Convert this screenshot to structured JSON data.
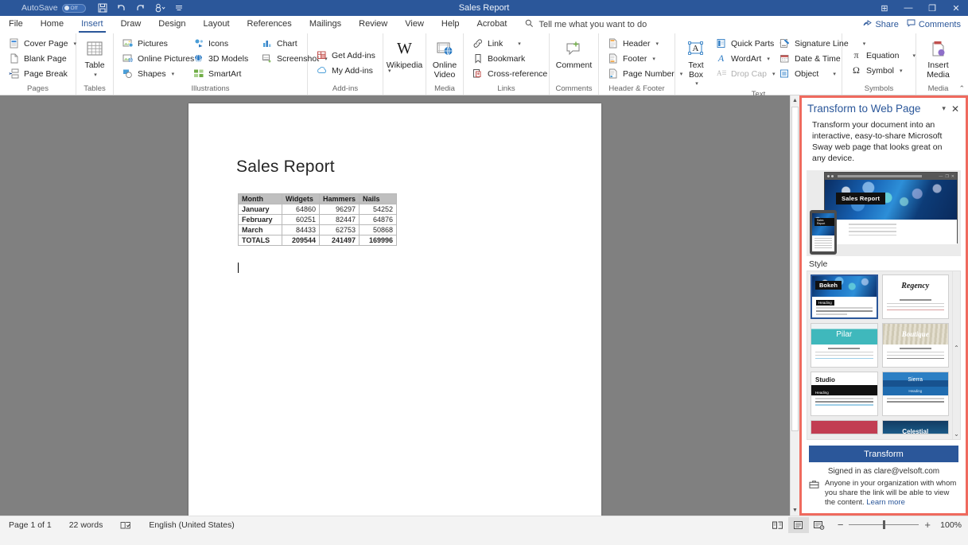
{
  "titlebar": {
    "autosave_label": "AutoSave",
    "autosave_state": "Off",
    "document_title": "Sales Report",
    "qat": [
      {
        "name": "save-icon",
        "tooltip": "Save"
      },
      {
        "name": "undo-icon",
        "tooltip": "Undo"
      },
      {
        "name": "redo-icon",
        "tooltip": "Redo"
      },
      {
        "name": "customize-qat-icon",
        "tooltip": "Customize Quick Access Toolbar"
      },
      {
        "name": "ribbon-display-options-icon",
        "tooltip": "Ribbon Display Options"
      }
    ],
    "window_buttons": {
      "restore_down_pane": "⊞",
      "minimize": "—",
      "maximize": "❐",
      "close": "✕"
    }
  },
  "tabs": [
    {
      "label": "File",
      "active": false
    },
    {
      "label": "Home",
      "active": false
    },
    {
      "label": "Insert",
      "active": true
    },
    {
      "label": "Draw",
      "active": false
    },
    {
      "label": "Design",
      "active": false
    },
    {
      "label": "Layout",
      "active": false
    },
    {
      "label": "References",
      "active": false
    },
    {
      "label": "Mailings",
      "active": false
    },
    {
      "label": "Review",
      "active": false
    },
    {
      "label": "View",
      "active": false
    },
    {
      "label": "Help",
      "active": false
    },
    {
      "label": "Acrobat",
      "active": false
    }
  ],
  "tellme": {
    "placeholder": "Tell me what you want to do"
  },
  "share": {
    "share_label": "Share",
    "comments_label": "Comments"
  },
  "ribbon": {
    "collapse_label": "⌃",
    "groups": [
      {
        "label": "Pages",
        "items": [
          {
            "label": "Cover Page",
            "icon": "cover-page-icon",
            "dropdown": true
          },
          {
            "label": "Blank Page",
            "icon": "blank-page-icon",
            "dropdown": false
          },
          {
            "label": "Page Break",
            "icon": "page-break-icon",
            "dropdown": false
          }
        ]
      },
      {
        "label": "Tables",
        "big_items": [
          {
            "label": "Table",
            "icon": "table-icon",
            "dropdown": true
          }
        ]
      },
      {
        "label": "Illustrations",
        "items": [
          {
            "label": "Pictures",
            "icon": "pictures-icon",
            "dropdown": false
          },
          {
            "label": "Online Pictures",
            "icon": "online-pictures-icon",
            "dropdown": false
          },
          {
            "label": "Shapes",
            "icon": "shapes-icon",
            "dropdown": true
          },
          {
            "label": "Icons",
            "icon": "icons-icon",
            "dropdown": false
          },
          {
            "label": "3D Models",
            "icon": "3d-models-icon",
            "dropdown": true
          },
          {
            "label": "SmartArt",
            "icon": "smartart-icon",
            "dropdown": false
          },
          {
            "label": "Chart",
            "icon": "chart-icon",
            "dropdown": false
          },
          {
            "label": "Screenshot",
            "icon": "screenshot-icon",
            "dropdown": true
          }
        ]
      },
      {
        "label": "Add-ins",
        "items": [
          {
            "label": "Get Add-ins",
            "icon": "get-addins-icon",
            "dropdown": false
          },
          {
            "label": "My Add-ins",
            "icon": "my-addins-icon",
            "dropdown": true
          }
        ]
      },
      {
        "label": "",
        "big_items": [
          {
            "label": "Wikipedia",
            "icon": "wikipedia-icon",
            "dropdown": false
          }
        ]
      },
      {
        "label": "Media",
        "big_items": [
          {
            "label": "Online Video",
            "icon": "online-video-icon",
            "dropdown": false
          }
        ]
      },
      {
        "label": "Links",
        "items": [
          {
            "label": "Link",
            "icon": "link-icon",
            "dropdown": true
          },
          {
            "label": "Bookmark",
            "icon": "bookmark-icon",
            "dropdown": false
          },
          {
            "label": "Cross-reference",
            "icon": "cross-reference-icon",
            "dropdown": false
          }
        ]
      },
      {
        "label": "Comments",
        "big_items": [
          {
            "label": "Comment",
            "icon": "comment-icon",
            "dropdown": false
          }
        ]
      },
      {
        "label": "Header & Footer",
        "items": [
          {
            "label": "Header",
            "icon": "header-icon",
            "dropdown": true
          },
          {
            "label": "Footer",
            "icon": "footer-icon",
            "dropdown": true
          },
          {
            "label": "Page Number",
            "icon": "page-number-icon",
            "dropdown": true
          }
        ]
      },
      {
        "label": "Text",
        "big_items": [
          {
            "label": "Text Box",
            "icon": "text-box-icon",
            "dropdown": true
          }
        ],
        "items": [
          {
            "label": "Quick Parts",
            "icon": "quick-parts-icon",
            "dropdown": true
          },
          {
            "label": "WordArt",
            "icon": "wordart-icon",
            "dropdown": true
          },
          {
            "label": "Drop Cap",
            "icon": "drop-cap-icon",
            "dropdown": true,
            "disabled": true
          },
          {
            "label": "Signature Line",
            "icon": "signature-line-icon",
            "dropdown": true
          },
          {
            "label": "Date & Time",
            "icon": "date-time-icon",
            "dropdown": false
          },
          {
            "label": "Object",
            "icon": "object-icon",
            "dropdown": true
          }
        ]
      },
      {
        "label": "Symbols",
        "items": [
          {
            "label": "Equation",
            "icon": "equation-icon",
            "dropdown": true
          },
          {
            "label": "Symbol",
            "icon": "symbol-icon",
            "dropdown": true
          }
        ]
      },
      {
        "label": "Media",
        "big_items": [
          {
            "label": "Insert Media",
            "icon": "insert-media-icon",
            "dropdown": false
          }
        ]
      }
    ]
  },
  "document": {
    "heading": "Sales Report",
    "table": {
      "headers": [
        "Month",
        "Widgets",
        "Hammers",
        "Nails"
      ],
      "rows": [
        {
          "month": "January",
          "widgets": "64860",
          "hammers": "96297",
          "nails": "54252"
        },
        {
          "month": "February",
          "widgets": "60251",
          "hammers": "82447",
          "nails": "64876"
        },
        {
          "month": "March",
          "widgets": "84433",
          "hammers": "62753",
          "nails": "50868"
        },
        {
          "month": "TOTALS",
          "widgets": "209544",
          "hammers": "241497",
          "nails": "169996"
        }
      ]
    }
  },
  "taskpane": {
    "title": "Transform to Web Page",
    "dropdown_icon": "chevron-down-icon",
    "close_icon": "close-icon",
    "description": "Transform your document into an interactive, easy-to-share Microsoft Sway web page that looks great on any device.",
    "preview": {
      "hero_label": "Sales Report"
    },
    "style_label": "Style",
    "styles": [
      {
        "name": "Bokeh",
        "selected": true
      },
      {
        "name": "Regency",
        "selected": false
      },
      {
        "name": "Pilar",
        "selected": false
      },
      {
        "name": "Boutique",
        "selected": false
      },
      {
        "name": "Studio",
        "selected": false
      },
      {
        "name": "Sierra",
        "selected": false
      },
      {
        "name": "",
        "selected": false
      },
      {
        "name": "Celestial",
        "selected": false
      }
    ],
    "scroll_up_icon": "chevron-up-icon",
    "scroll_down_icon": "chevron-down-icon",
    "transform_button": "Transform",
    "signed_in": "Signed in as clare@velsoft.com",
    "share_note": "Anyone in your organization with whom you share the link will be able to view the content.",
    "learn_more": "Learn more",
    "highlight_color": "#ef6a5e"
  },
  "statusbar": {
    "page": "Page 1 of 1",
    "words": "22 words",
    "proofing_icon": "proofing-errors-icon",
    "language": "English (United States)",
    "views": [
      {
        "name": "read-mode-icon",
        "active": false
      },
      {
        "name": "print-layout-icon",
        "active": true
      },
      {
        "name": "web-layout-icon",
        "active": false
      }
    ],
    "zoom_out": "−",
    "zoom_in": "+",
    "zoom_value": "100%"
  },
  "colors": {
    "word_blue": "#2b579a",
    "ribbon_bg": "#ffffff",
    "doc_bg": "#808080",
    "highlight": "#ef6a5e"
  }
}
